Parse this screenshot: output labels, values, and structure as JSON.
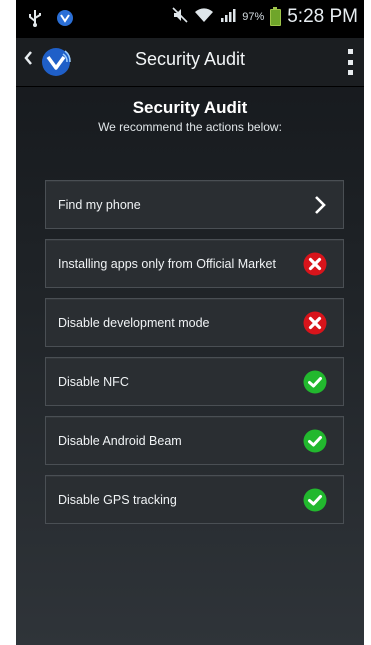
{
  "status_bar": {
    "battery_percent": "97%",
    "time": "5:28 PM",
    "icons": [
      "usb-icon",
      "notification-icon",
      "mute-icon",
      "wifi-icon",
      "signal-icon",
      "battery-icon"
    ]
  },
  "action_bar": {
    "title": "Security Audit",
    "icons": [
      "back-icon",
      "app-logo-icon",
      "overflow-menu-icon"
    ]
  },
  "header": {
    "title": "Security Audit",
    "subtitle": "We recommend the actions below:"
  },
  "items": [
    {
      "label": "Find my phone",
      "status": "chevron"
    },
    {
      "label": "Installing apps only from Official Market",
      "status": "fail"
    },
    {
      "label": "Disable development mode",
      "status": "fail"
    },
    {
      "label": "Disable NFC",
      "status": "pass"
    },
    {
      "label": "Disable Android Beam",
      "status": "pass"
    },
    {
      "label": "Disable GPS tracking",
      "status": "pass"
    }
  ],
  "colors": {
    "pass": "#22b82e",
    "fail": "#d8141b",
    "chevron": "#ffffff"
  }
}
